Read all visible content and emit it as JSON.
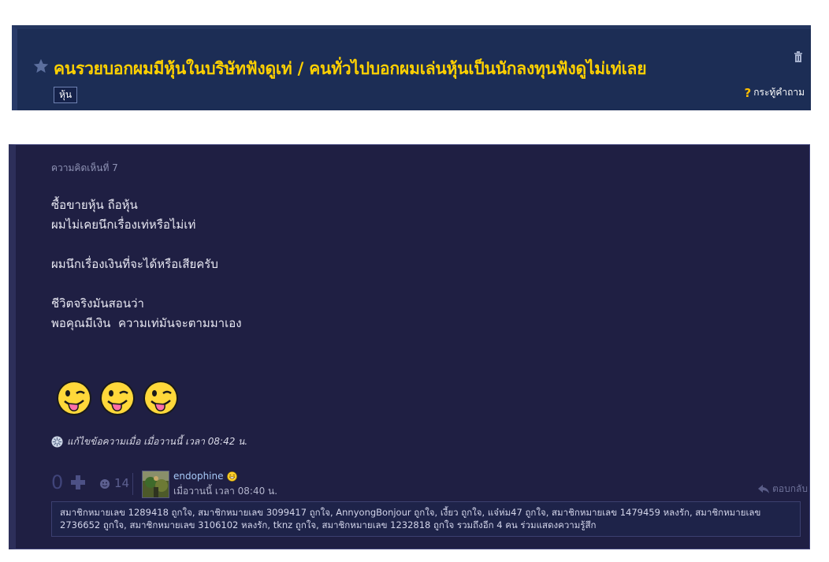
{
  "topic": {
    "title": "คนรวยบอกผมมีหุ้นในบริษัทฟังดูเท่ / คนทั่วไปบอกผมเล่นหุ้นเป็นนักลงทุนฟังดูไม่เท่เลย",
    "tag": "หุ้น",
    "type_label": "กระทู้คำถาม",
    "icons": [
      "star-icon",
      "trash-icon",
      "question-mark-icon"
    ],
    "colors": {
      "header_bg": "#1c2d55",
      "title": "#ffd100"
    }
  },
  "comment": {
    "number_label": "ความคิดเห็นที่ 7",
    "body_lines": [
      "ซื้อขายหุ้น ถือหุ้น",
      "ผมไม่เคยนึกเรื่องเท่หรือไม่เท่",
      "",
      "ผมนึกเรื่องเงินที่จะได้หรือเสียครับ",
      "",
      "ชีวิตจริงมันสอนว่า",
      "พอคุณมีเงิน  ความเท่มันจะตามมาเอง"
    ],
    "emojis": [
      "tongue-wink-emoji",
      "tongue-wink-emoji",
      "tongue-wink-emoji"
    ],
    "edit_note": "แก้ไขข้อความเมื่อ เมื่อวานนี้ เวลา 08:42 น.",
    "vote_count": "0",
    "emotion_count": "14",
    "author": "endophine",
    "timestamp": "เมื่อวานนี้ เวลา 08:40 น.",
    "reply_label": "ตอบกลับ",
    "reactions_text": "สมาชิกหมายเลข 1289418 ถูกใจ, สมาชิกหมายเลข 3099417 ถูกใจ, AnnyongBonjour ถูกใจ, เงี้ยว ถูกใจ, แจ๋ห่ม47 ถูกใจ, สมาชิกหมายเลข 1479459 หลงรัก, สมาชิกหมายเลข 2736652 ถูกใจ, สมาชิกหมายเลข 3106102 หลงรัก, tknz ถูกใจ, สมาชิกหมายเลข 1232818 ถูกใจ รวมถึงอีก 4 คน ร่วมแสดงความรู้สึก",
    "colors": {
      "comment_bg": "#1f1f43",
      "author_link": "#a7c9f7"
    }
  }
}
